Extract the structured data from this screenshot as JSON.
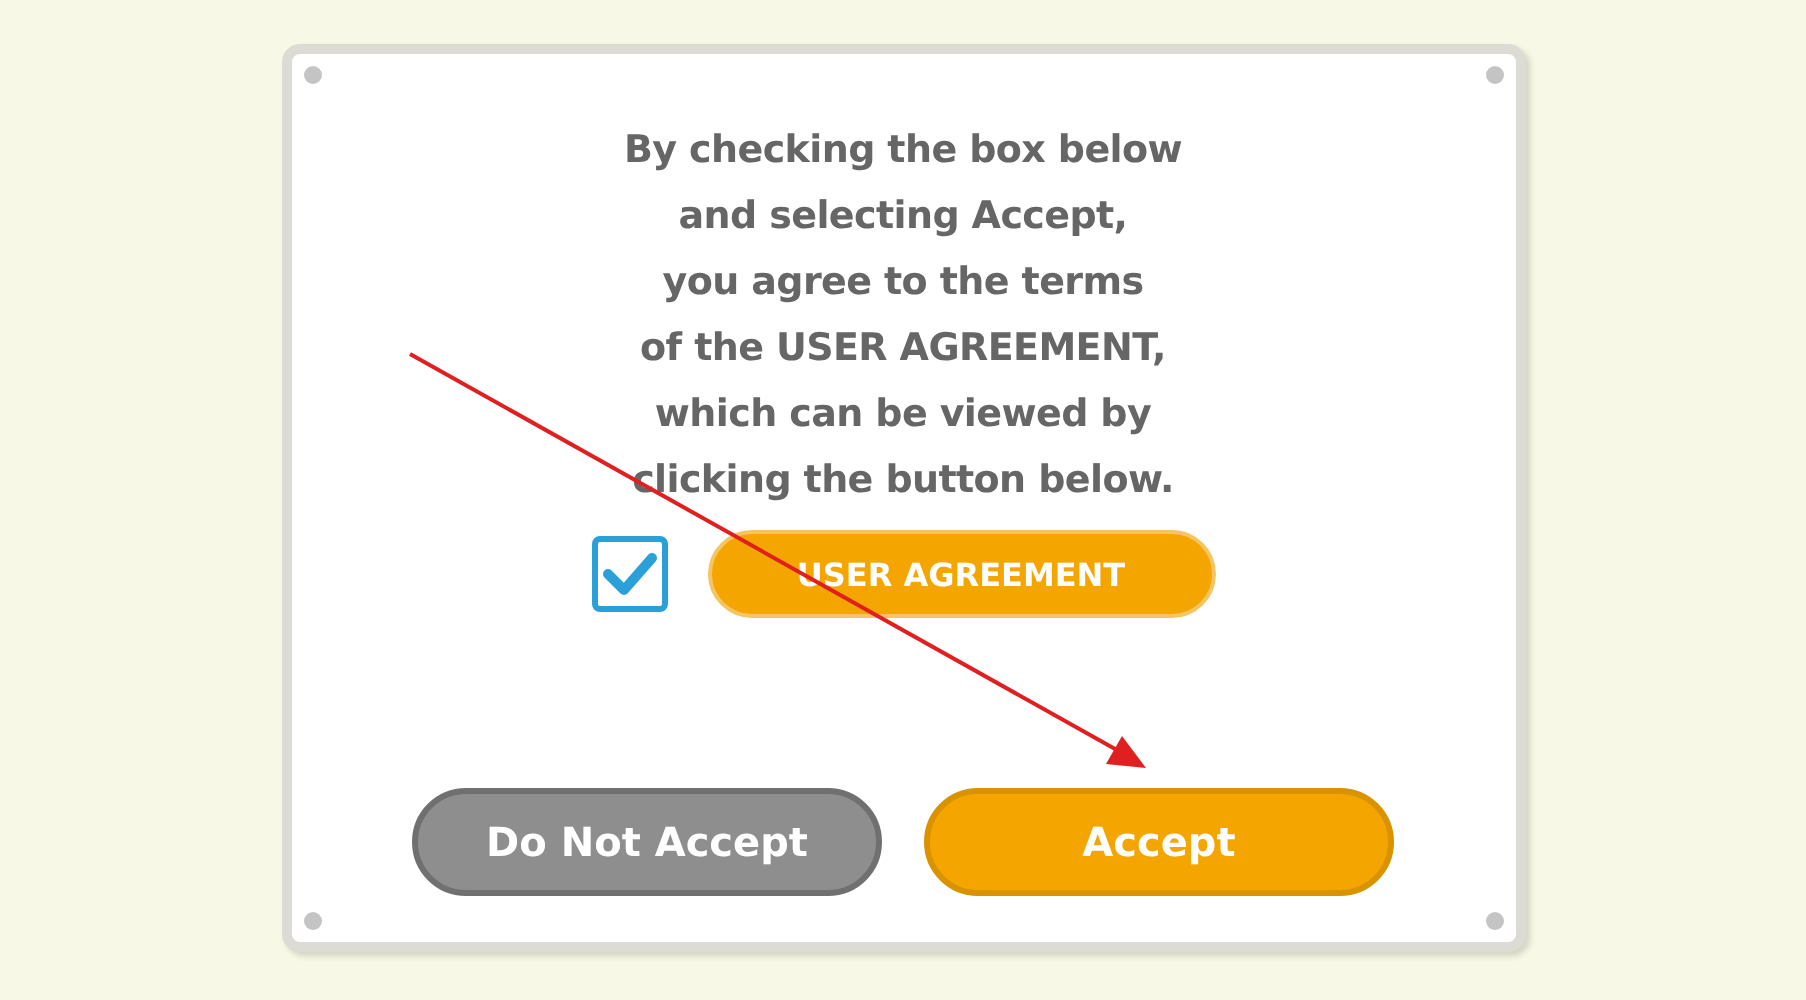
{
  "dialog": {
    "message": "By checking the box below\nand selecting Accept,\nyou agree to the terms\nof the USER AGREEMENT,\nwhich can be viewed by\nclicking the button below.",
    "checkbox": {
      "checked": true
    },
    "agreement_button": "USER AGREEMENT",
    "buttons": [
      {
        "label": "Do Not Accept",
        "kind": "secondary"
      },
      {
        "label": "Accept",
        "kind": "primary"
      }
    ]
  }
}
